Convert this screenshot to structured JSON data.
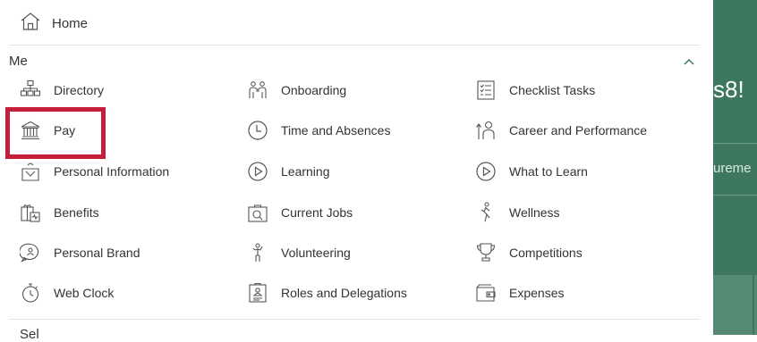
{
  "home": {
    "label": "Home",
    "icon": "home-icon"
  },
  "section": {
    "title": "Me",
    "items": [
      {
        "label": "Directory",
        "icon": "directory-icon"
      },
      {
        "label": "Onboarding",
        "icon": "onboarding-icon"
      },
      {
        "label": "Checklist Tasks",
        "icon": "checklist-icon"
      },
      {
        "label": "Pay",
        "icon": "bank-icon"
      },
      {
        "label": "Time and Absences",
        "icon": "clock-icon"
      },
      {
        "label": "Career and Performance",
        "icon": "career-icon"
      },
      {
        "label": "Personal Information",
        "icon": "personal-info-icon"
      },
      {
        "label": "Learning",
        "icon": "play-circle-icon"
      },
      {
        "label": "What to Learn",
        "icon": "play-circle-icon"
      },
      {
        "label": "Benefits",
        "icon": "benefits-icon"
      },
      {
        "label": "Current Jobs",
        "icon": "jobs-search-icon"
      },
      {
        "label": "Wellness",
        "icon": "wellness-icon"
      },
      {
        "label": "Personal Brand",
        "icon": "personal-brand-icon"
      },
      {
        "label": "Volunteering",
        "icon": "volunteer-icon"
      },
      {
        "label": "Competitions",
        "icon": "trophy-icon"
      },
      {
        "label": "Web Clock",
        "icon": "stopwatch-icon"
      },
      {
        "label": "Roles and Delegations",
        "icon": "roles-icon"
      },
      {
        "label": "Expenses",
        "icon": "wallet-icon"
      }
    ]
  },
  "next_section": {
    "title": "Sel"
  },
  "right_panel": {
    "greeting": "s8!",
    "subtext": "ureme"
  },
  "colors": {
    "accent_green": "#3d7760",
    "highlight_red": "#c51f3c",
    "text": "#333333"
  }
}
